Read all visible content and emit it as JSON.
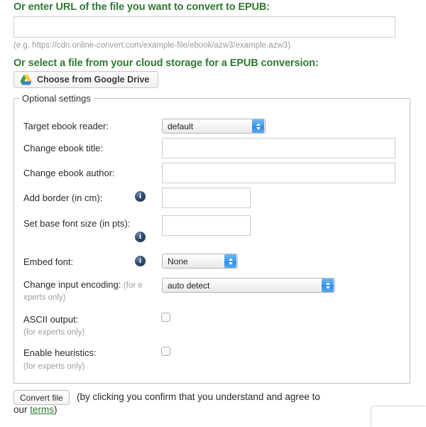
{
  "url_section": {
    "heading": "Or enter URL of the file you want to convert to EPUB:",
    "input_value": "",
    "input_placeholder": "",
    "hint": "(e.g. https://cdn.online-convert.com/example-file/ebook/azw3/example.azw3)"
  },
  "cloud_section": {
    "heading": "Or select a file from your cloud storage for a EPUB conversion:",
    "gdrive_button_label": "Choose from Google Drive",
    "gdrive_icon": "google-drive-icon"
  },
  "optional_settings": {
    "legend": "Optional settings",
    "rows": {
      "target_reader": {
        "label": "Target ebook reader:",
        "value": "default",
        "control": "select"
      },
      "ebook_title": {
        "label": "Change ebook title:",
        "value": "",
        "control": "text"
      },
      "ebook_author": {
        "label": "Change ebook author:",
        "value": "",
        "control": "text"
      },
      "add_border": {
        "label": "Add border (in cm):",
        "value": "",
        "control": "text",
        "info_icon": "info-icon"
      },
      "base_font_size": {
        "label": "Set base font size (in pts):",
        "value": "",
        "control": "text",
        "info_icon": "info-icon"
      },
      "embed_font": {
        "label": "Embed font:",
        "value": "None",
        "control": "select",
        "info_icon": "info-icon"
      },
      "input_encoding": {
        "label": "Change input encoding:",
        "note_line1": "(for e",
        "note_line2": "xperts only)",
        "value": "auto detect",
        "control": "select"
      },
      "ascii_output": {
        "label": "ASCII output:",
        "note": "(for experts only)",
        "checked": false,
        "control": "checkbox"
      },
      "enable_heuristics": {
        "label": "Enable heuristics:",
        "note": "(for experts only)",
        "checked": false,
        "control": "checkbox"
      }
    }
  },
  "footer": {
    "convert_button_label": "Convert file",
    "terms_text_line1": "(by clicking you confirm that you understand and agree to",
    "terms_prefix_line2": "our ",
    "terms_link_label": "terms",
    "terms_suffix_line2": ")"
  },
  "colors": {
    "heading_green": "#2f7a33",
    "link_green": "#2f7a33",
    "select_arrow_blue": "#3e9cef",
    "info_icon_navy": "#1d3050",
    "hint_gray": "#9b9b9b",
    "border_gray": "#bfbfbf"
  }
}
